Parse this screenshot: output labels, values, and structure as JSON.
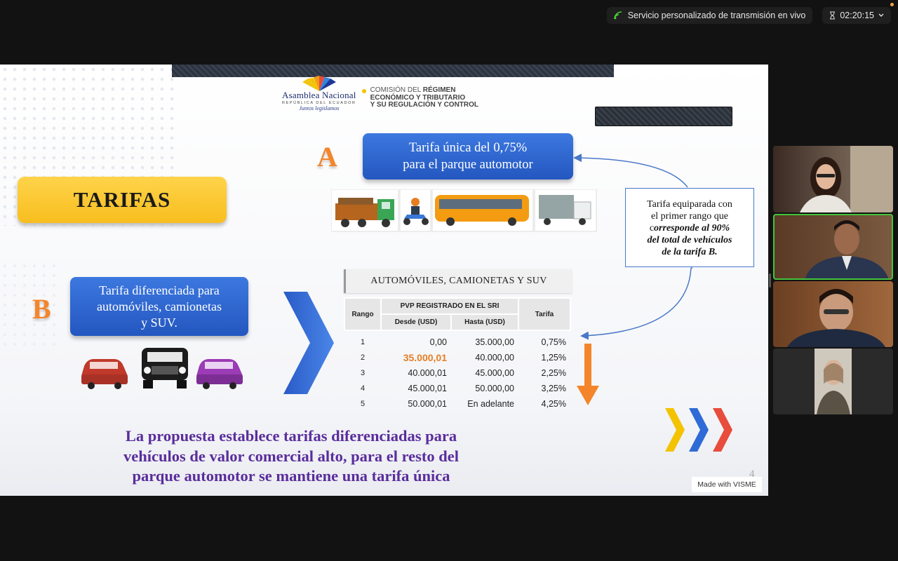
{
  "status": {
    "live_label": "Servicio personalizado de transmisión en vivo",
    "timer": "02:20:15"
  },
  "slide": {
    "logo": {
      "name": "Asamblea Nacional",
      "subtitle": "REPÚBLICA DEL ECUADOR",
      "tagline": "Juntos legislamos"
    },
    "commission": {
      "line1": "COMISIÓN DEL ",
      "line1_bold": "RÉGIMEN",
      "line2": "ECONÓMICO Y TRIBUTARIO",
      "line3": "Y SU REGULACIÓN Y CONTROL"
    },
    "title": "TARIFAS",
    "section_a": {
      "letter": "A",
      "line1": "Tarifa única del 0,75%",
      "line2": "para el parque automotor"
    },
    "section_b": {
      "letter": "B",
      "line1": "Tarifa diferenciada para",
      "line2": "automóviles, camionetas",
      "line3": "y SUV."
    },
    "info": {
      "line1": "Tarifa equiparada con",
      "line2": "el primer rango que",
      "line3_prefix": "c",
      "line3": "orresponde al 90%",
      "line4": "del total de vehículos",
      "line5": "de la tarifa B."
    },
    "table": {
      "title": "AUTOMÓVILES, CAMIONETAS Y SUV",
      "header_range": "Rango",
      "header_pvp": "PVP REGISTRADO EN EL SRI",
      "header_from": "Desde (USD)",
      "header_to": "Hasta (USD)",
      "header_rate": "Tarifa",
      "rows": [
        {
          "range": "1",
          "from": "0,00",
          "to": "35.000,00",
          "rate": "0,75%"
        },
        {
          "range": "2",
          "from": "35.000,01",
          "to": "40.000,00",
          "rate": "1,25%"
        },
        {
          "range": "3",
          "from": "40.000,01",
          "to": "45.000,00",
          "rate": "2,25%"
        },
        {
          "range": "4",
          "from": "45.000,01",
          "to": "50.000,00",
          "rate": "3,25%"
        },
        {
          "range": "5",
          "from": "50.000,01",
          "to": "En adelante",
          "rate": "4,25%"
        }
      ]
    },
    "bottom": {
      "line1": "La propuesta establece tarifas diferenciadas para",
      "line2": "vehículos de valor comercial alto, para el resto del",
      "line3": "parque automotor se mantiene una tarifa única"
    },
    "page_number": "4",
    "watermark": "Made with VISME"
  },
  "colors": {
    "accent_blue": "#2f66d0",
    "accent_orange": "#f4852a",
    "title_yellow": "#f7be1e",
    "bottom_text": "#5a2d9c",
    "active_speaker": "#43c43a"
  }
}
